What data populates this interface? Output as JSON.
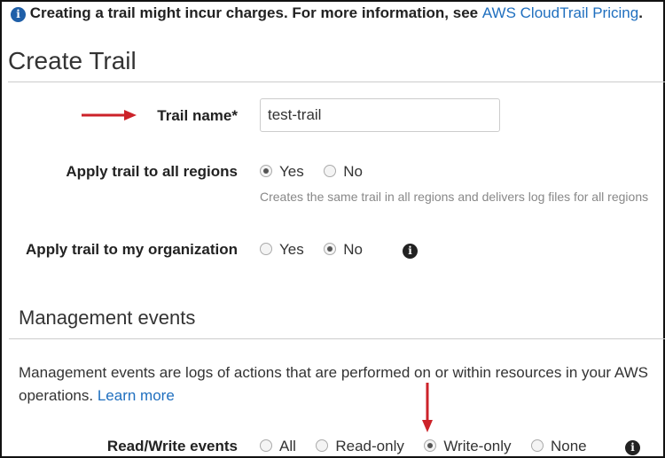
{
  "banner": {
    "text": "Creating a trail might incur charges. For more information, see ",
    "link": "AWS CloudTrail Pricing",
    "suffix": "."
  },
  "title": "Create Trail",
  "trail_name": {
    "label": "Trail name*",
    "value": "test-trail"
  },
  "all_regions": {
    "label": "Apply trail to all regions",
    "options": [
      "Yes",
      "No"
    ],
    "selected": "Yes",
    "help": "Creates the same trail in all regions and delivers log files for all regions"
  },
  "organization": {
    "label": "Apply trail to my organization",
    "options": [
      "Yes",
      "No"
    ],
    "selected": "No"
  },
  "management": {
    "heading": "Management events",
    "description": "Management events are logs of actions that are performed on or within resources in your AWS",
    "description2": "operations. ",
    "learn_more": "Learn more"
  },
  "read_write": {
    "label": "Read/Write events",
    "options": [
      "All",
      "Read-only",
      "Write-only",
      "None"
    ],
    "selected": "Write-only"
  },
  "colors": {
    "accent": "#1f6fbf",
    "arrow": "#cc2229"
  }
}
